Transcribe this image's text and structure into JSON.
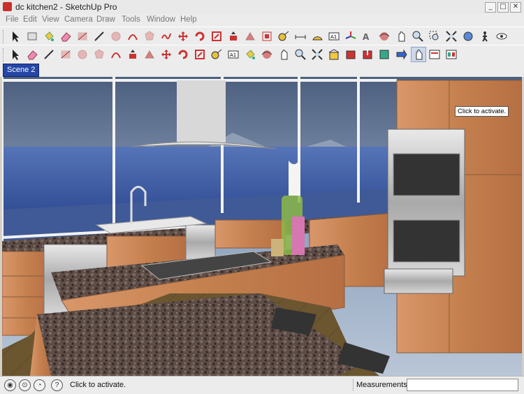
{
  "window": {
    "title": "dc kitchen2 - SketchUp Pro",
    "minimize": "_",
    "maximize": "□",
    "close": "✕"
  },
  "menu": [
    "File",
    "Edit",
    "View",
    "Camera",
    "Draw",
    "Tools",
    "Window",
    "Help"
  ],
  "toolbar_row1": [
    "select-icon",
    "component-icon",
    "paint-bucket-icon",
    "eraser-icon",
    "rectangle-icon",
    "line-icon",
    "circle-icon",
    "arc-icon",
    "polygon-icon",
    "freehand-icon",
    "move-icon",
    "rotate-icon",
    "scale-icon",
    "push-pull-icon",
    "follow-me-icon",
    "offset-icon",
    "tape-measure-icon",
    "dimension-icon",
    "protractor-icon",
    "text-icon",
    "axes-icon",
    "3d-text-icon",
    "orbit-icon",
    "pan-icon",
    "zoom-icon",
    "zoom-window-icon",
    "zoom-extents-icon",
    "previous-view-icon",
    "walk-icon",
    "look-around-icon"
  ],
  "toolbar_row2": [
    "select-icon",
    "eraser-icon",
    "line-icon",
    "rectangle-icon",
    "circle-icon",
    "polygon-icon",
    "arc-icon",
    "push-pull-icon",
    "follow-me-icon",
    "move-icon",
    "rotate-icon",
    "scale-icon",
    "tape-measure-icon",
    "text-icon",
    "paint-bucket-icon",
    "orbit-icon",
    "pan-icon",
    "zoom-icon",
    "zoom-extents-icon",
    "warehouse-icon",
    "get-models-icon",
    "share-model-icon",
    "extension-icon",
    "send-icon",
    "interact-icon",
    "dynamic-options-icon",
    "dynamic-attributes-icon"
  ],
  "scene_tab": "Scene 2",
  "viewport_tooltip": "Click to activate.",
  "status": {
    "text": "Click to activate.",
    "measurements_label": "Measurements",
    "measurements_value": ""
  },
  "colors": {
    "scene_tab": "#2546a6",
    "sky": "#8fa3bf",
    "water": "#3b5aa8",
    "cabinet": "#c9875a",
    "granite": "#5a4a44",
    "floor": "#6b5630"
  }
}
